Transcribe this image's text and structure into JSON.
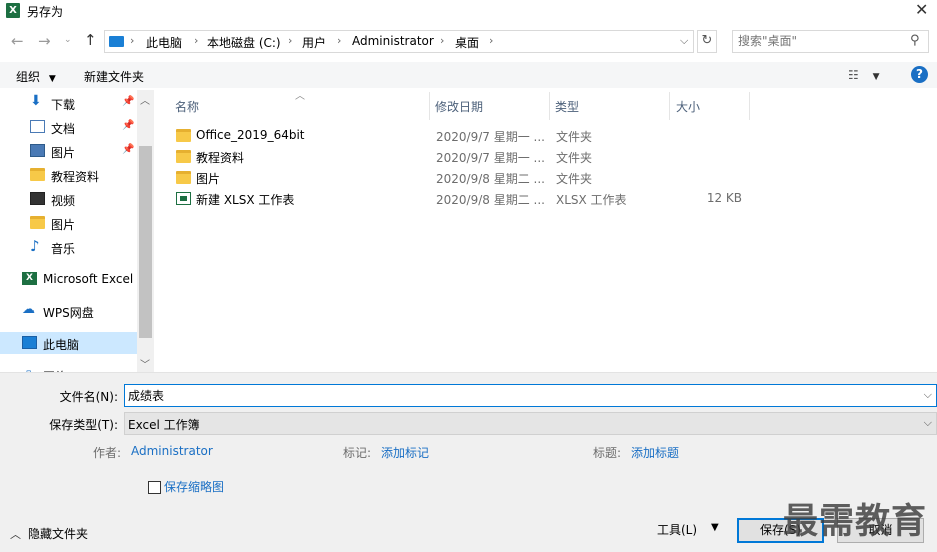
{
  "window": {
    "title": "另存为",
    "app_icon": "excel-icon"
  },
  "address": {
    "crumbs": [
      "此电脑",
      "本地磁盘 (C:)",
      "用户",
      "Administrator",
      "桌面"
    ],
    "search_placeholder": "搜索\"桌面\""
  },
  "toolbar": {
    "organize": "组织",
    "new_folder": "新建文件夹"
  },
  "nav": [
    {
      "label": "下载",
      "icon": "download-icon",
      "pinned": true
    },
    {
      "label": "文档",
      "icon": "document-icon",
      "pinned": true
    },
    {
      "label": "图片",
      "icon": "pictures-icon",
      "pinned": true
    },
    {
      "label": "教程资料",
      "icon": "folder-icon",
      "pinned": false
    },
    {
      "label": "视频",
      "icon": "video-icon",
      "pinned": false
    },
    {
      "label": "图片",
      "icon": "folder-icon",
      "pinned": false
    },
    {
      "label": "音乐",
      "icon": "music-icon",
      "pinned": false
    },
    {
      "label": "Microsoft Excel",
      "icon": "excel-icon",
      "pinned": false
    },
    {
      "label": "WPS网盘",
      "icon": "cloud-icon",
      "pinned": false
    },
    {
      "label": "此电脑",
      "icon": "computer-icon",
      "pinned": false,
      "selected": true
    },
    {
      "label": "网络",
      "icon": "network-icon",
      "pinned": false
    }
  ],
  "columns": {
    "name": "名称",
    "date": "修改日期",
    "type": "类型",
    "size": "大小"
  },
  "files": [
    {
      "name": "Office_2019_64bit",
      "date": "2020/9/7 星期一 ...",
      "type": "文件夹",
      "size": "",
      "icon": "folder-icon"
    },
    {
      "name": "教程资料",
      "date": "2020/9/7 星期一 ...",
      "type": "文件夹",
      "size": "",
      "icon": "folder-icon"
    },
    {
      "name": "图片",
      "date": "2020/9/8 星期二 ...",
      "type": "文件夹",
      "size": "",
      "icon": "folder-icon"
    },
    {
      "name": "新建 XLSX 工作表",
      "date": "2020/9/8 星期二 ...",
      "type": "XLSX 工作表",
      "size": "12 KB",
      "icon": "xlsx-file-icon"
    }
  ],
  "form": {
    "filename_label": "文件名(N):",
    "filename_value": "成绩表",
    "filetype_label": "保存类型(T):",
    "filetype_value": "Excel 工作簿",
    "author_label": "作者:",
    "author_value": "Administrator",
    "tags_label": "标记:",
    "tags_value": "添加标记",
    "title_label": "标题:",
    "title_value": "添加标题",
    "thumbnail_label": "保存缩略图",
    "hide_folders": "隐藏文件夹",
    "tools": "工具(L)",
    "save": "保存(S)",
    "cancel": "取消"
  },
  "watermark": "最需教育"
}
